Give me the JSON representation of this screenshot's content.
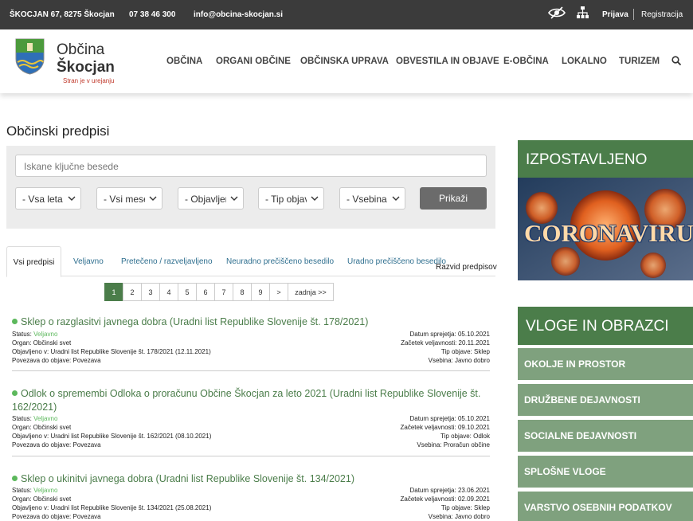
{
  "topbar": {
    "address": "ŠKOCJAN 67, 8275 Škocjan",
    "phone": "07 38 46 300",
    "email": "info@obcina-skocjan.si",
    "login": "Prijava",
    "register": "Registracija"
  },
  "header": {
    "brand_line1": "Občina",
    "brand_line2": "Škocjan",
    "tagline": "Stran je v urejanju",
    "nav": [
      "OBČINA",
      "ORGANI OBČINE",
      "OBČINSKA UPRAVA",
      "OBVESTILA IN OBJAVE",
      "E-OBČINA",
      "LOKALNO",
      "TURIZEM"
    ]
  },
  "main": {
    "title": "Občinski predpisi",
    "search_placeholder": "Iskane ključne besede",
    "filters": [
      "- Vsa leta",
      "- Vsi meseci",
      "- Objavljeno v",
      "- Tip objave",
      "- Vsebina"
    ],
    "submit": "Prikaži",
    "tabs": [
      "Vsi predpisi",
      "Veljavno",
      "Pretečeno / razveljavljeno",
      "Neuradno prečiščeno besedilo",
      "Uradno prečiščeno besedilo"
    ],
    "tab_extra": "Razvid predpisov",
    "pager": [
      "1",
      "2",
      "3",
      "4",
      "5",
      "6",
      "7",
      "8",
      "9",
      ">",
      "zadnja >>"
    ],
    "items": [
      {
        "title": "Sklep o razglasitvi javnega dobra (Uradni list Republike Slovenije št. 178/2021)",
        "status_label": "Status:",
        "status": "Veljavno",
        "organ": "Organ: Občinski svet",
        "published": "Objavljeno v: Uradni list Republike Slovenije št. 178/2021 (12.11.2021)",
        "link": "Povezava do objave: Povezava",
        "adopted": "Datum sprejetja: 05.10.2021",
        "valid_from": "Začetek veljavnosti: 20.11.2021",
        "type": "Tip objave: Sklep",
        "content": "Vsebina: Javno dobro"
      },
      {
        "title": "Odlok o spremembi Odloka o proračunu Občine Škocjan za leto 2021 (Uradni list Republike Slovenije št. 162/2021)",
        "status_label": "Status:",
        "status": "Veljavno",
        "organ": "Organ: Občinski svet",
        "published": "Objavljeno v: Uradni list Republike Slovenije št. 162/2021 (08.10.2021)",
        "link": "Povezava do objave: Povezava",
        "adopted": "Datum sprejetja: 05.10.2021",
        "valid_from": "Začetek veljavnosti: 09.10.2021",
        "type": "Tip objave: Odlok",
        "content": "Vsebina: Proračun občine"
      },
      {
        "title": "Sklep o ukinitvi javnega dobra (Uradni list Republike Slovenije št. 134/2021)",
        "status_label": "Status:",
        "status": "Veljavno",
        "organ": "Organ: Občinski svet",
        "published": "Objavljeno v: Uradni list Republike Slovenije št. 134/2021 (25.08.2021)",
        "link": "Povezava do objave: Povezava",
        "adopted": "Datum sprejetja: 23.06.2021",
        "valid_from": "Začetek veljavnosti: 02.09.2021",
        "type": "Tip objave: Sklep",
        "content": "Vsebina: Javno dobro"
      }
    ]
  },
  "sidebar": {
    "featured_title": "IZPOSTAVLJENO",
    "banner_text": "CORONAVIRUS",
    "forms_title": "VLOGE IN OBRAZCI",
    "links": [
      "OKOLJE IN PROSTOR",
      "DRUŽBENE DEJAVNOSTI",
      "SOCIALNE DEJAVNOSTI",
      "SPLOŠNE VLOGE",
      "VARSTVO OSEBNIH PODATKOV"
    ]
  },
  "colors": {
    "topbar": "#3b3b3b",
    "brand_green": "#4b7d4a",
    "link_green": "#7fa17e",
    "status_green": "#5cb85c",
    "tagline_red": "#c0392b"
  },
  "icons": [
    "eye-slash-icon",
    "sitemap-icon",
    "search-icon",
    "chevron-down-icon"
  ]
}
